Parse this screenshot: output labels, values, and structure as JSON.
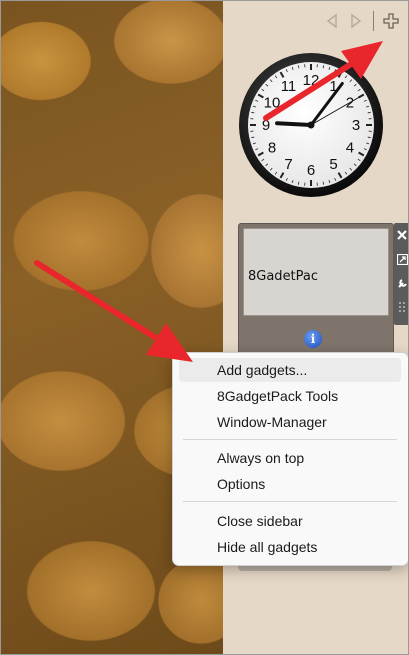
{
  "sidebar": {
    "nav": {
      "prev_icon": "triangle-left-icon",
      "next_icon": "triangle-right-icon",
      "add_icon": "plus-icon"
    },
    "clock": {
      "numbers": [
        "12",
        "1",
        "2",
        "3",
        "4",
        "5",
        "6",
        "7",
        "8",
        "9",
        "10",
        "11"
      ],
      "time": "9:06:10"
    },
    "gadget_tile": {
      "label": "8GadetPac",
      "info_icon": "info-icon",
      "info_glyph": "i"
    },
    "gadget_toolbar": {
      "close_icon": "close-icon",
      "resize_icon": "resize-icon",
      "settings_icon": "wrench-icon",
      "drag_icon": "drag-handle-icon"
    }
  },
  "context_menu": {
    "items": [
      {
        "label": "Add gadgets..."
      },
      {
        "label": "8GadgetPack Tools"
      },
      {
        "label": "Window-Manager"
      },
      {
        "label": "Always on top"
      },
      {
        "label": "Options"
      },
      {
        "label": "Close sidebar"
      },
      {
        "label": "Hide all gadgets"
      }
    ]
  },
  "annotations": {
    "arrow_color": "#e8262b"
  },
  "colors": {
    "sidebar_bg": "#e6d8c6",
    "menu_bg": "#f9f9f9",
    "menu_hover": "#ebebeb"
  }
}
